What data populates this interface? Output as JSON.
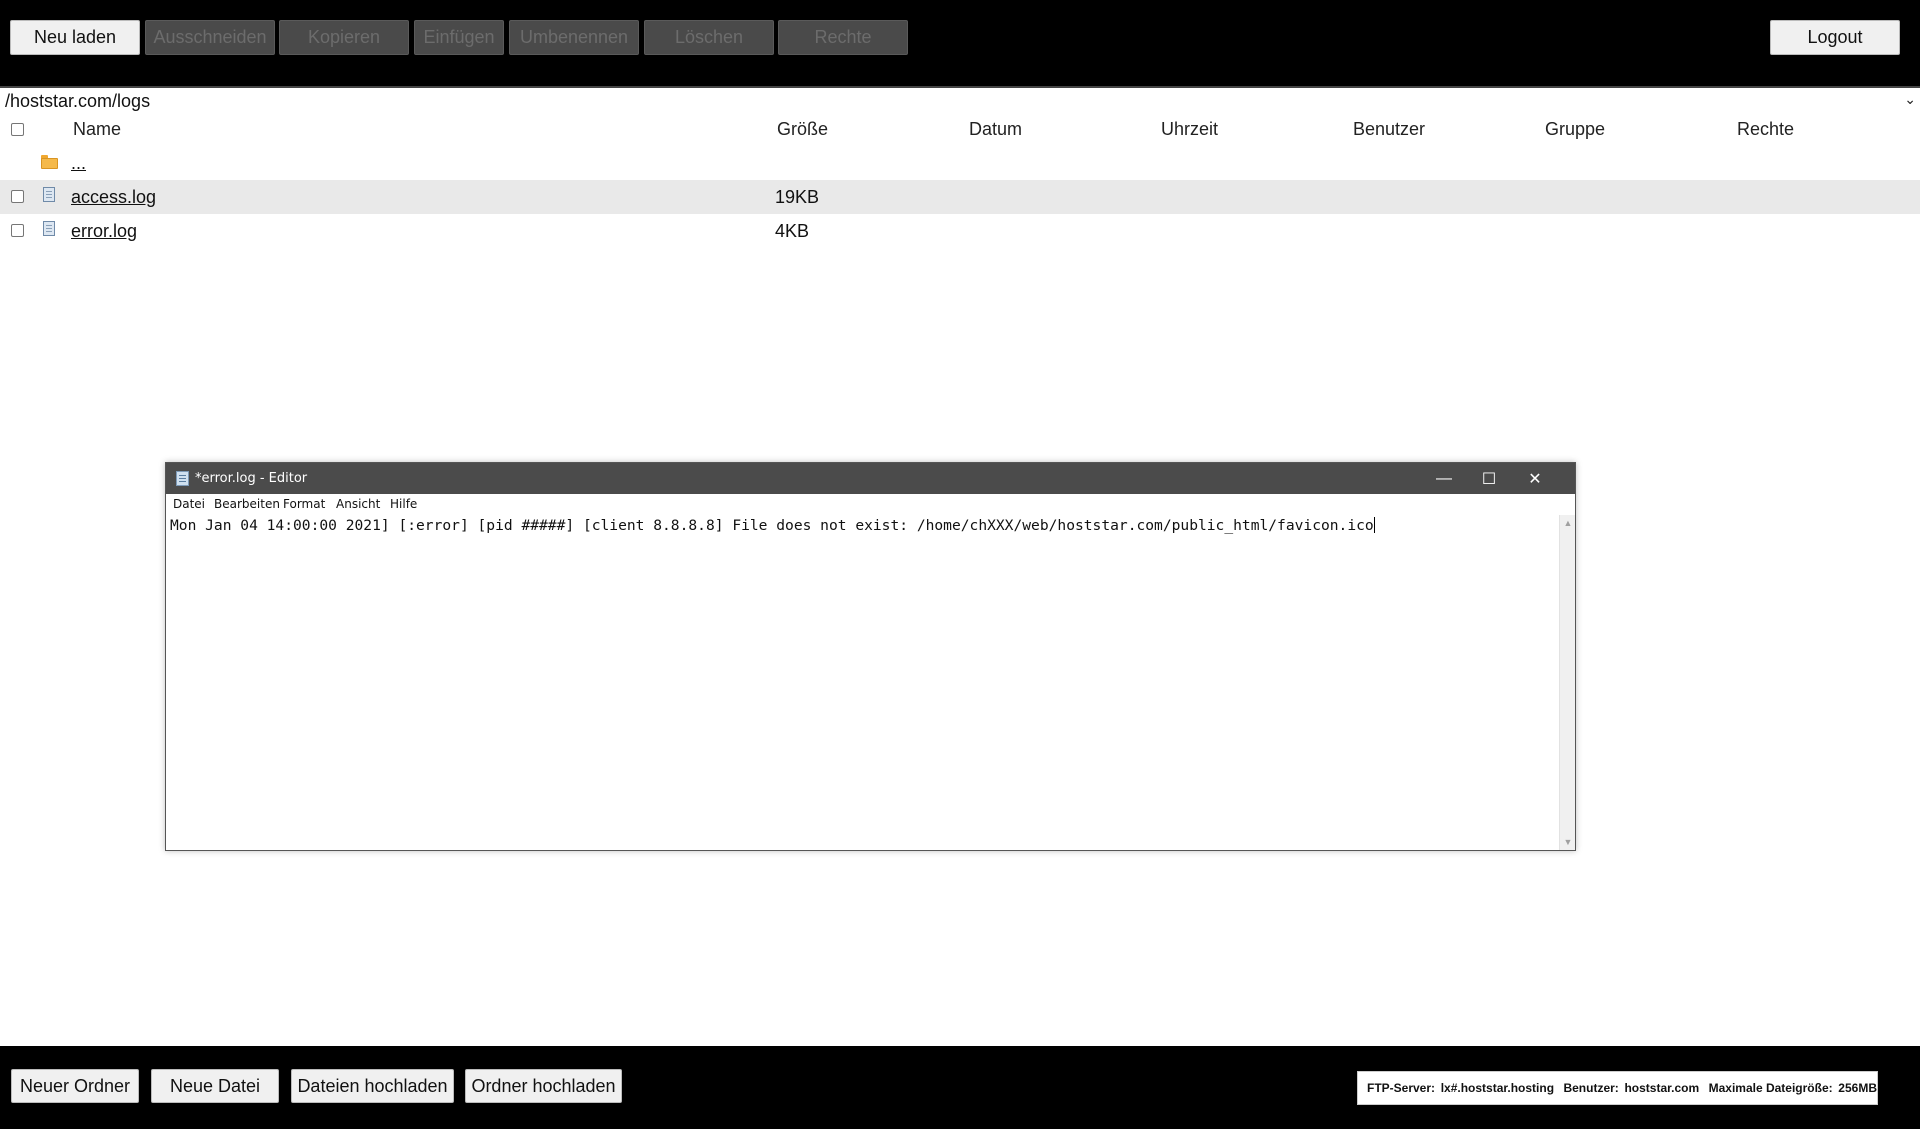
{
  "toolbar": {
    "reload": "Neu laden",
    "cut": "Ausschneiden",
    "copy": "Kopieren",
    "paste": "Einfügen",
    "rename": "Umbenennen",
    "delete": "Löschen",
    "permissions": "Rechte",
    "logout": "Logout"
  },
  "path": "/hoststar.com/logs",
  "columns": {
    "name": "Name",
    "size": "Größe",
    "date": "Datum",
    "time": "Uhrzeit",
    "user": "Benutzer",
    "group": "Gruppe",
    "rights": "Rechte"
  },
  "parent_link": "...",
  "files": [
    {
      "name": "access.log",
      "size": "19KB",
      "icon": "file-icon"
    },
    {
      "name": "error.log",
      "size": "4KB",
      "icon": "file-icon"
    }
  ],
  "editor": {
    "title": "*error.log - Editor",
    "menu": {
      "file": "Datei",
      "edit": "Bearbeiten",
      "format": "Format",
      "view": "Ansicht",
      "help": "Hilfe"
    },
    "content": "Mon Jan 04 14:00:00 2021] [:error] [pid #####] [client 8.8.8.8] File does not exist: /home/chXXX/web/hoststar.com/public_html/favicon.ico",
    "buttons": {
      "minimize": "—",
      "maximize": "☐",
      "close": "✕"
    }
  },
  "bottombar": {
    "new_folder": "Neuer Ordner",
    "new_file": "Neue Datei",
    "upload_files": "Dateien hochladen",
    "upload_folder": "Ordner hochladen",
    "info": {
      "ftp_label": "FTP-Server:",
      "ftp_value": "lx#.hoststar.hosting",
      "user_label": "Benutzer:",
      "user_value": "hoststar.com",
      "maxsize_label": "Maximale Dateigröße:",
      "maxsize_value": "256MB"
    }
  },
  "colors": {
    "bar_bg": "#000000",
    "disabled_button": "#4a4a4a",
    "row_highlight": "#e9e9e9",
    "editor_titlebar": "#4b4b4b",
    "folder": "#f5b94a"
  }
}
